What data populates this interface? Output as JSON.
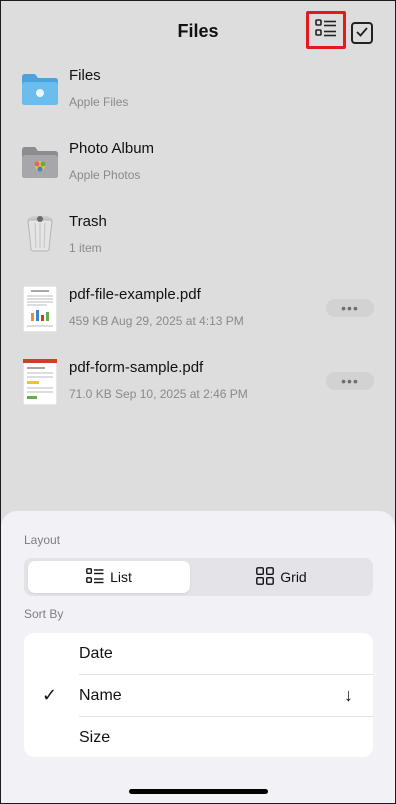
{
  "nav": {
    "title": "Files",
    "list_icon": "list-view-icon",
    "select_icon": "checkmark-square-icon"
  },
  "files": [
    {
      "name": "Files",
      "sub": "Apple Files",
      "icon": "blue-folder-icon"
    },
    {
      "name": "Photo Album",
      "sub": "Apple Photos",
      "icon": "photos-folder-icon"
    },
    {
      "name": "Trash",
      "sub": "1 item",
      "icon": "trash-icon"
    },
    {
      "name": "pdf-file-example.pdf",
      "sub": "459 KB Aug 29, 2025 at 4:13 PM",
      "icon": "pdf-thumbnail-icon",
      "more": "•••"
    },
    {
      "name": "pdf-form-sample.pdf",
      "sub": "71.0 KB Sep 10, 2025 at 2:46 PM",
      "icon": "pdf-thumbnail-icon",
      "more": "•••"
    }
  ],
  "sheet": {
    "layout_label": "Layout",
    "layout_options": [
      {
        "label": "List",
        "icon": "list-icon",
        "active": true
      },
      {
        "label": "Grid",
        "icon": "grid-icon",
        "active": false
      }
    ],
    "sort_label": "Sort By",
    "sort_options": [
      {
        "label": "Date",
        "checked": false
      },
      {
        "label": "Name",
        "checked": true,
        "direction_icon": "arrow-down-icon",
        "direction": "↓"
      },
      {
        "label": "Size",
        "checked": false
      }
    ],
    "check_glyph": "✓"
  },
  "colors": {
    "highlight_border": "#e01b1b",
    "folder_blue": "#5ab1e6",
    "folder_gray": "#9b9ba0"
  }
}
